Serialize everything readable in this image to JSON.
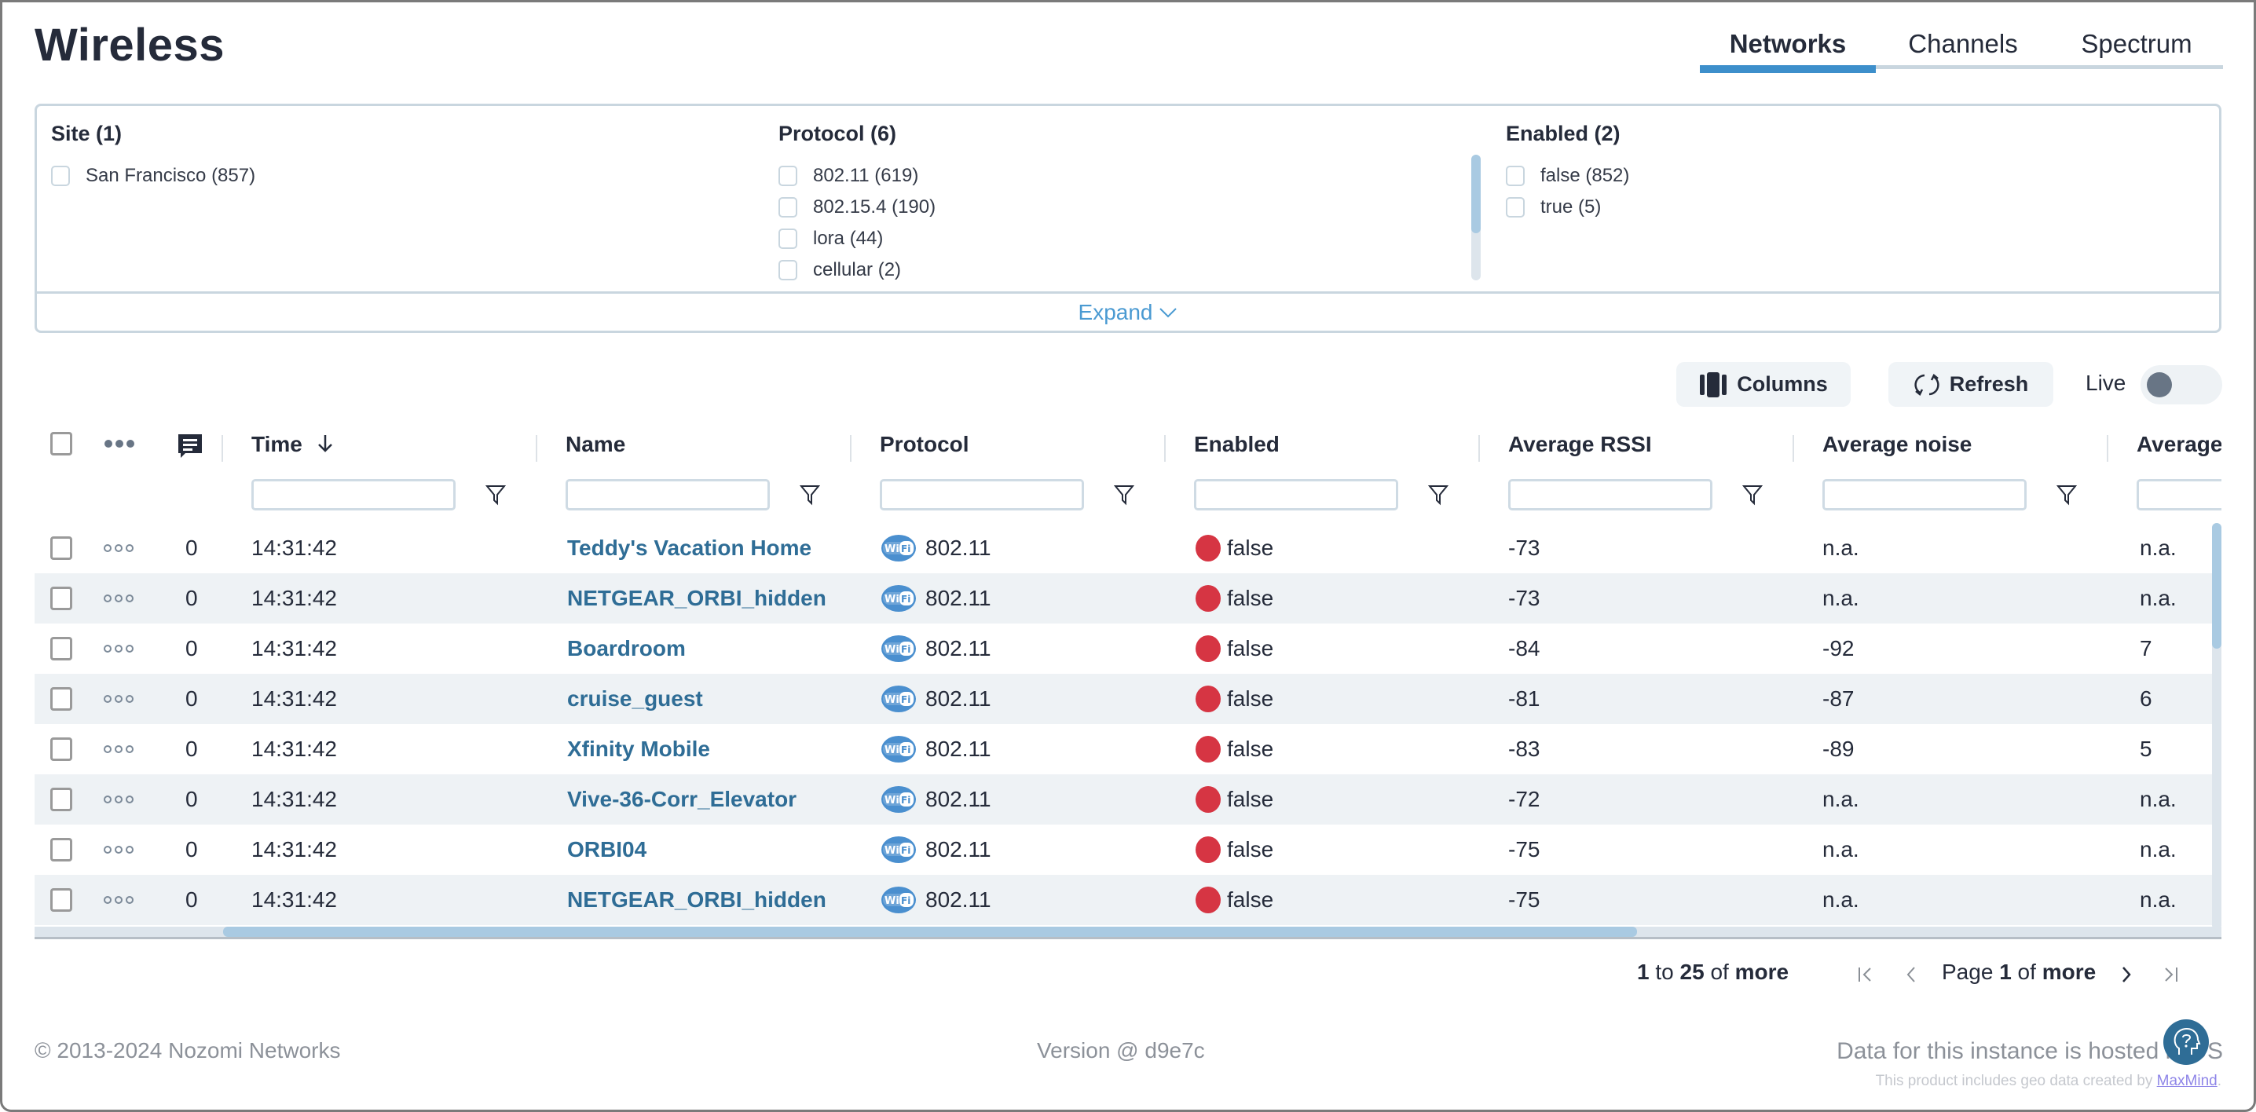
{
  "page": {
    "title": "Wireless"
  },
  "tabs": [
    {
      "label": "Networks",
      "active": true
    },
    {
      "label": "Channels",
      "active": false
    },
    {
      "label": "Spectrum",
      "active": false
    }
  ],
  "filters": {
    "groups": [
      {
        "title": "Site (1)",
        "items": [
          "San Francisco (857)"
        ]
      },
      {
        "title": "Protocol (6)",
        "items": [
          "802.11 (619)",
          "802.15.4 (190)",
          "lora (44)",
          "cellular (2)"
        ]
      },
      {
        "title": "Enabled (2)",
        "items": [
          "false (852)",
          "true (5)"
        ]
      }
    ],
    "expand_label": "Expand"
  },
  "toolbar": {
    "columns_label": "Columns",
    "refresh_label": "Refresh",
    "live_label": "Live",
    "live_on": false
  },
  "table": {
    "columns": [
      "Time",
      "Name",
      "Protocol",
      "Enabled",
      "Average RSSI",
      "Average noise",
      "Average"
    ],
    "sort_column": "Time",
    "sort_direction": "descending",
    "rows": [
      {
        "comments": "0",
        "time": "14:31:42",
        "name": "Teddy's Vacation Home",
        "protocol": "802.11",
        "enabled": "false",
        "rssi": "-73",
        "noise": "n.a.",
        "avg": "n.a."
      },
      {
        "comments": "0",
        "time": "14:31:42",
        "name": "NETGEAR_ORBI_hidden",
        "protocol": "802.11",
        "enabled": "false",
        "rssi": "-73",
        "noise": "n.a.",
        "avg": "n.a."
      },
      {
        "comments": "0",
        "time": "14:31:42",
        "name": "Boardroom",
        "protocol": "802.11",
        "enabled": "false",
        "rssi": "-84",
        "noise": "-92",
        "avg": "7"
      },
      {
        "comments": "0",
        "time": "14:31:42",
        "name": "cruise_guest",
        "protocol": "802.11",
        "enabled": "false",
        "rssi": "-81",
        "noise": "-87",
        "avg": "6"
      },
      {
        "comments": "0",
        "time": "14:31:42",
        "name": "Xfinity Mobile",
        "protocol": "802.11",
        "enabled": "false",
        "rssi": "-83",
        "noise": "-89",
        "avg": "5"
      },
      {
        "comments": "0",
        "time": "14:31:42",
        "name": "Vive-36-Corr_Elevator",
        "protocol": "802.11",
        "enabled": "false",
        "rssi": "-72",
        "noise": "n.a.",
        "avg": "n.a."
      },
      {
        "comments": "0",
        "time": "14:31:42",
        "name": "ORBI04",
        "protocol": "802.11",
        "enabled": "false",
        "rssi": "-75",
        "noise": "n.a.",
        "avg": "n.a."
      },
      {
        "comments": "0",
        "time": "14:31:42",
        "name": "NETGEAR_ORBI_hidden",
        "protocol": "802.11",
        "enabled": "false",
        "rssi": "-75",
        "noise": "n.a.",
        "avg": "n.a."
      }
    ]
  },
  "pagination": {
    "range_from": "1",
    "range_to_label": "to",
    "range_to": "25",
    "of_label": "of",
    "total": "more",
    "page_label": "Page",
    "page": "1",
    "page_of_label": "of",
    "page_total": "more"
  },
  "footer": {
    "copyright": "© 2013-2024 Nozomi Networks",
    "version": "Version @ d9e7c",
    "hosted": "Data for this instance is hosted in US",
    "geo_text": "This product includes geo data created by",
    "geo_link": "MaxMind",
    "geo_end": "."
  },
  "colors": {
    "accent": "#3d8fcb",
    "link": "#2f6d96",
    "status_false": "#d63543"
  }
}
